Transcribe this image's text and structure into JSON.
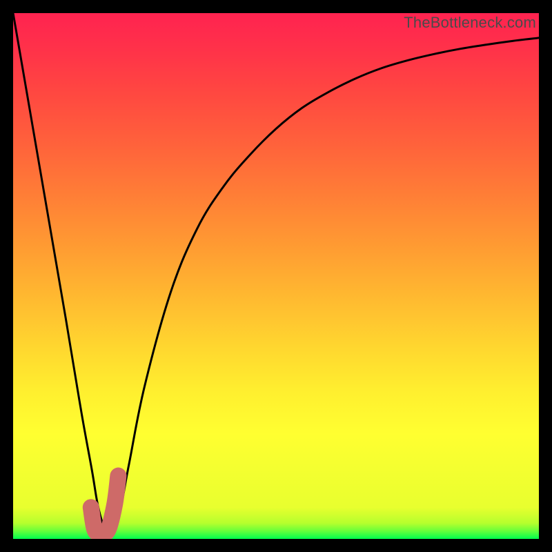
{
  "watermark": "TheBottleneck.com",
  "chart_data": {
    "type": "line",
    "title": "",
    "xlabel": "",
    "ylabel": "",
    "xlim": [
      0,
      100
    ],
    "ylim": [
      0,
      100
    ],
    "series": [
      {
        "name": "bottleneck-curve",
        "x": [
          0,
          5,
          10,
          13,
          15,
          16,
          17,
          18,
          20,
          22,
          25,
          30,
          35,
          40,
          45,
          50,
          55,
          60,
          65,
          70,
          75,
          80,
          85,
          90,
          95,
          100
        ],
        "values": [
          100,
          71,
          42,
          24,
          13,
          7,
          3,
          1,
          4,
          14,
          29,
          47,
          59,
          67,
          73,
          78,
          82,
          85,
          87.5,
          89.5,
          91,
          92.2,
          93.2,
          94,
          94.7,
          95.3
        ]
      }
    ],
    "marker": {
      "name": "highlight-j",
      "x": [
        14.8,
        15.5,
        16.5,
        18.0,
        19.3,
        20.0
      ],
      "y": [
        6.0,
        1.8,
        1.2,
        1.6,
        6.5,
        12.0
      ],
      "color": "#ce6a68"
    },
    "gradient_stops": [
      {
        "offset": 0.0,
        "color": "#00ff4e"
      },
      {
        "offset": 0.015,
        "color": "#66ff3a"
      },
      {
        "offset": 0.03,
        "color": "#b6ff2d"
      },
      {
        "offset": 0.06,
        "color": "#e8ff2f"
      },
      {
        "offset": 0.2,
        "color": "#ffff30"
      },
      {
        "offset": 0.28,
        "color": "#ffef2f"
      },
      {
        "offset": 0.36,
        "color": "#ffd82f"
      },
      {
        "offset": 0.45,
        "color": "#ffbc30"
      },
      {
        "offset": 0.55,
        "color": "#ff9d32"
      },
      {
        "offset": 0.65,
        "color": "#ff7f36"
      },
      {
        "offset": 0.75,
        "color": "#ff623b"
      },
      {
        "offset": 0.85,
        "color": "#ff4741"
      },
      {
        "offset": 0.93,
        "color": "#ff3249"
      },
      {
        "offset": 1.0,
        "color": "#ff2350"
      }
    ]
  }
}
